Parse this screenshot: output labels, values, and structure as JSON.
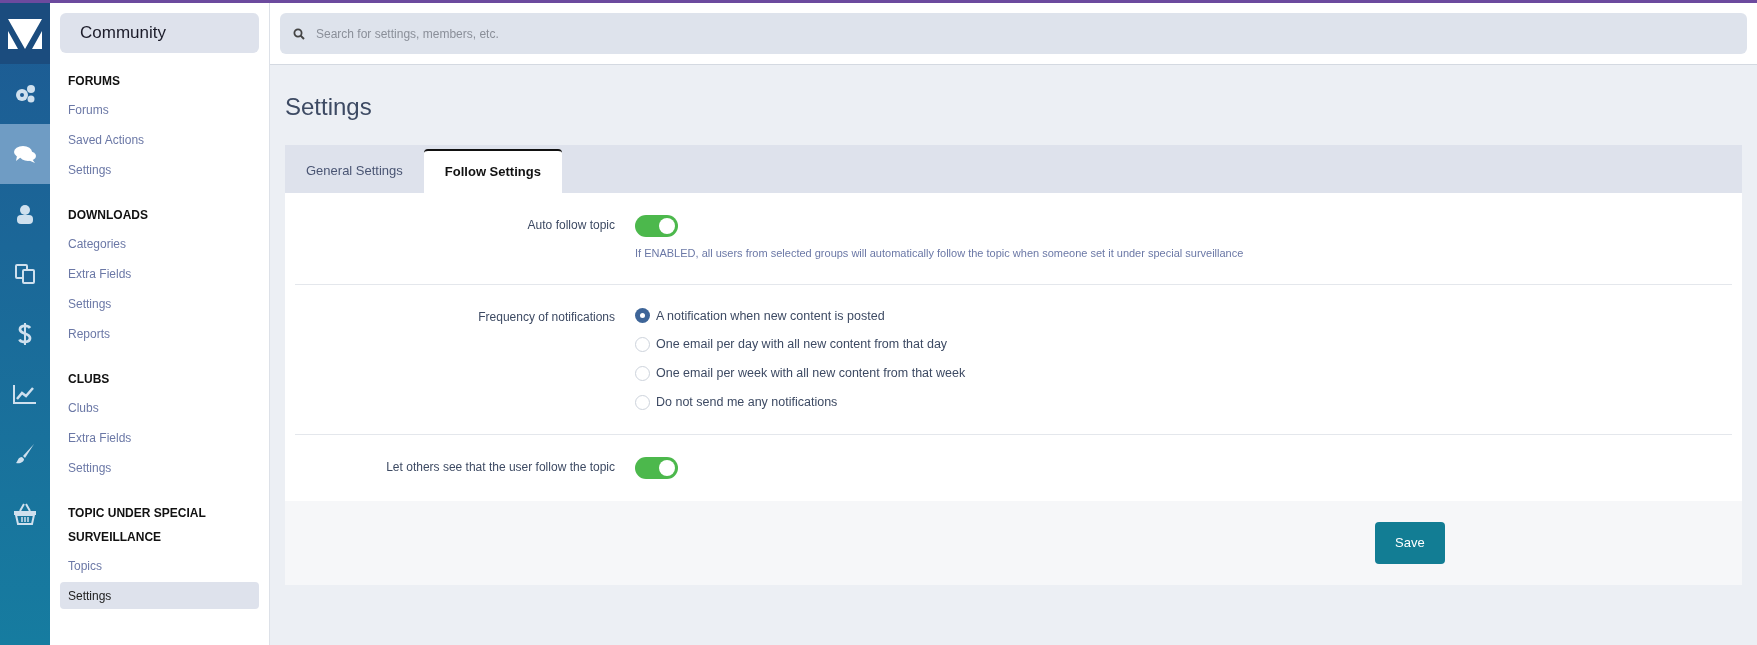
{
  "rail": [
    {
      "selected": false
    },
    {
      "selected": true
    },
    {
      "selected": false
    },
    {
      "selected": false
    },
    {
      "selected": false
    },
    {
      "selected": false
    },
    {
      "selected": false
    },
    {
      "selected": false
    }
  ],
  "sidebar": {
    "title": "Community",
    "sections": [
      {
        "heading": "FORUMS",
        "items": [
          {
            "label": "Forums",
            "selected": false
          },
          {
            "label": "Saved Actions",
            "selected": false
          },
          {
            "label": "Settings",
            "selected": false
          }
        ]
      },
      {
        "heading": "DOWNLOADS",
        "items": [
          {
            "label": "Categories",
            "selected": false
          },
          {
            "label": "Extra Fields",
            "selected": false
          },
          {
            "label": "Settings",
            "selected": false
          },
          {
            "label": "Reports",
            "selected": false
          }
        ]
      },
      {
        "heading": "CLUBS",
        "items": [
          {
            "label": "Clubs",
            "selected": false
          },
          {
            "label": "Extra Fields",
            "selected": false
          },
          {
            "label": "Settings",
            "selected": false
          }
        ]
      },
      {
        "heading": "TOPIC UNDER SPECIAL SURVEILLANCE",
        "items": [
          {
            "label": "Topics",
            "selected": false
          },
          {
            "label": "Settings",
            "selected": true
          }
        ]
      }
    ]
  },
  "search": {
    "placeholder": "Search for settings, members, etc."
  },
  "page_title": "Settings",
  "tabs": [
    {
      "label": "General Settings",
      "selected": false
    },
    {
      "label": "Follow Settings",
      "selected": true
    }
  ],
  "rows": [
    {
      "kind": "toggle",
      "label": "Auto follow topic",
      "on": true,
      "description": "If ENABLED, all users from selected groups will automatically follow the topic when someone set it under special surveillance"
    },
    {
      "kind": "radio",
      "label": "Frequency of notifications",
      "options": [
        {
          "label": "A notification when new content is posted",
          "selected": true
        },
        {
          "label": "One email per day with all new content from that day",
          "selected": false
        },
        {
          "label": "One email per week with all new content from that week",
          "selected": false
        },
        {
          "label": "Do not send me any notifications",
          "selected": false
        }
      ]
    },
    {
      "kind": "toggle",
      "label": "Let others see that the user follow the topic",
      "on": true
    }
  ],
  "save_button": "Save"
}
